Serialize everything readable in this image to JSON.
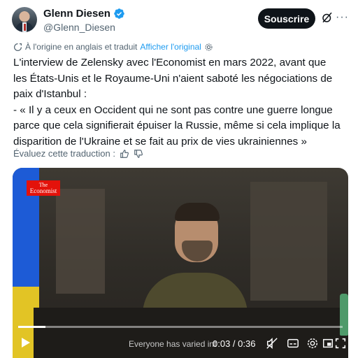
{
  "author": {
    "display_name": "Glenn Diesen",
    "handle": "@Glenn_Diesen",
    "verified_icon": "verified-badge-icon"
  },
  "actions": {
    "subscribe_label": "Souscrire",
    "grok_icon": "grok-icon",
    "more_icon": "more-icon"
  },
  "translation": {
    "note": "À l'origine en anglais et traduit",
    "show_original": "Afficher l'original",
    "rate_label": "Évaluez cette traduction :"
  },
  "tweet": {
    "text": "L'interview de Zelensky avec l'Economist en mars 2022, avant que les États-Unis et le Royaume-Uni n'aient saboté les négociations de paix d'Istanbul :\n- « Il y a ceux en Occident qui ne sont pas contre une guerre longue parce que cela signifierait épuiser la Russie, même si cela implique la disparition de l'Ukraine et se fait au prix de vies ukrainiennes »"
  },
  "video": {
    "logo_line1": "The",
    "logo_line2": "Economist",
    "subtitle_text": "Everyone has varied int",
    "time_display": "0:03 / 0:36",
    "progress_fraction": 0.083
  },
  "colors": {
    "accent": "#1d9bf0",
    "text_primary": "#0f1419",
    "text_secondary": "#536471",
    "economist_red": "#e3120b"
  }
}
